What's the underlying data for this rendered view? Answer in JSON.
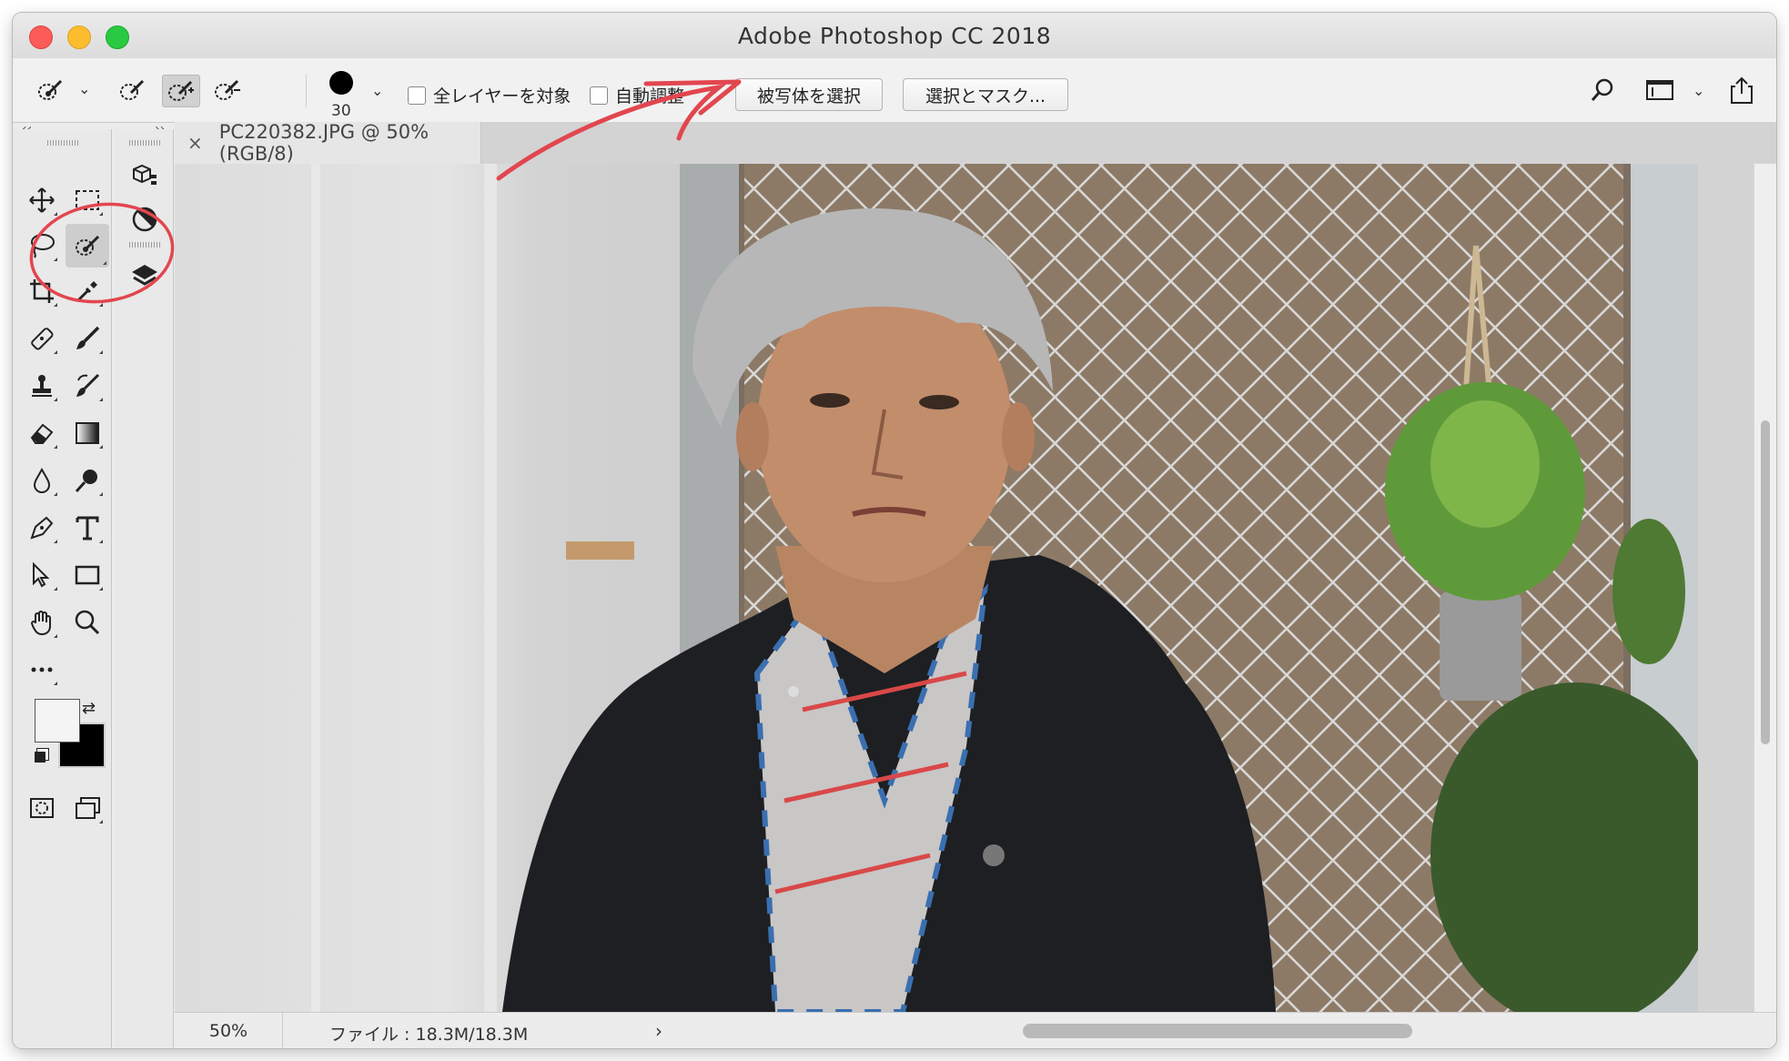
{
  "window": {
    "title": "Adobe Photoshop CC 2018"
  },
  "options_bar": {
    "brush_size": "30",
    "sample_all_layers_label": "全レイヤーを対象",
    "auto_enhance_label": "自動調整",
    "select_subject_label": "被写体を選択",
    "select_and_mask_label": "選択とマスク..."
  },
  "panels": {
    "left_collapse": "‹‹",
    "right_expand": "››"
  },
  "document": {
    "tab_title": "PC220382.JPG @ 50% (RGB/8)",
    "close_glyph": "×"
  },
  "status_bar": {
    "zoom": "50%",
    "file_info": "ファイル : 18.3M/18.3M",
    "arrow": "›"
  },
  "colors": {
    "annotation_red": "#e2464f",
    "foreground": "#000000",
    "background": "#f4f4f4"
  }
}
